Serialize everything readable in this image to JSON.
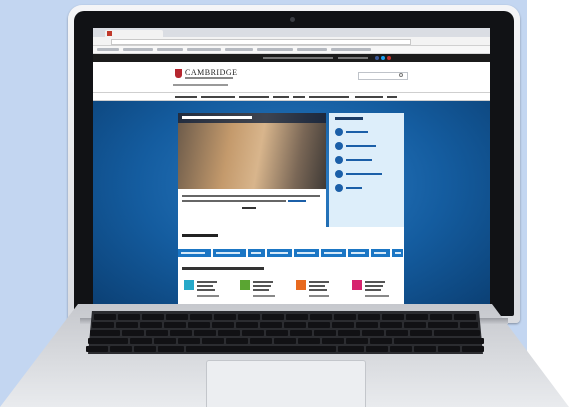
{
  "scene": {
    "background_color": "#c3d6f1",
    "laptop_color": "#dfe1e5",
    "keyboard_color": "#111114"
  },
  "browser": {
    "tab_title": "",
    "url": ""
  },
  "website": {
    "logo_text": "CAMBRIDGE",
    "accent_blue": "#1b76c4",
    "brand_red": "#b5262f",
    "qualification_colors": [
      "#27a9c9",
      "#5aa532",
      "#e86a1f",
      "#d6246e"
    ]
  }
}
